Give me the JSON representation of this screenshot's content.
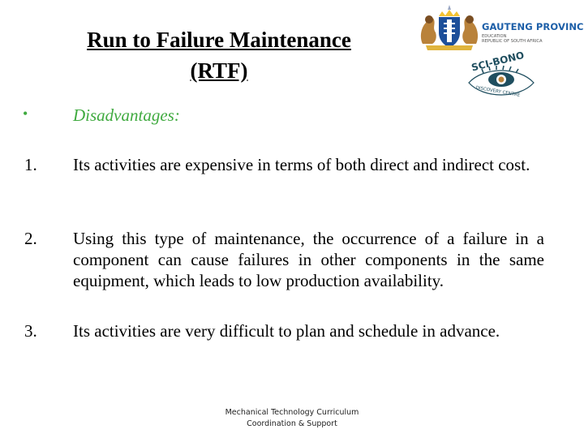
{
  "slide": {
    "title_line1": "Run to Failure Maintenance",
    "title_line2": "(RTF)",
    "bullet": {
      "symbol": "•",
      "label": "Disadvantages:",
      "color": "#3faa3f"
    },
    "items": [
      {
        "number": "1.",
        "text": "Its activities are expensive in terms of both direct and indirect cost."
      },
      {
        "number": "2.",
        "text": "Using this type of maintenance, the occurrence of a failure in a component can cause failures in other components in the same equipment, which leads to low production availability."
      },
      {
        "number": "3.",
        "text": "Its activities are very difficult to plan and schedule in advance."
      }
    ],
    "footer_line1": "Mechanical Technology Curriculum",
    "footer_line2": "Coordination & Support"
  },
  "logos": {
    "gauteng": {
      "icon": "coat-of-arms-icon",
      "name": "GAUTENG PROVINCE",
      "dept": "EDUCATION",
      "country": "REPUBLIC OF SOUTH AFRICA",
      "color": "#1d5fa8"
    },
    "scibono": {
      "icon": "eye-icon",
      "name": "SCI-BONO",
      "tagline": "DISCOVERY CENTRE",
      "color": "#1f4e5f"
    }
  }
}
